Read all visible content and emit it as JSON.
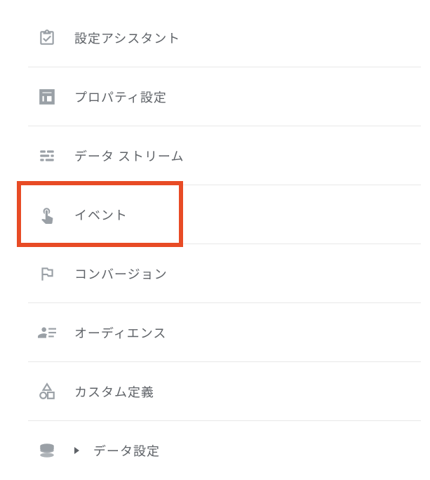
{
  "menu": {
    "items": [
      {
        "label": "設定アシスタント",
        "icon": "clipboard-check-icon"
      },
      {
        "label": "プロパティ設定",
        "icon": "layout-icon"
      },
      {
        "label": "データ ストリーム",
        "icon": "stream-icon"
      },
      {
        "label": "イベント",
        "icon": "touch-icon",
        "highlighted": true
      },
      {
        "label": "コンバージョン",
        "icon": "flag-icon"
      },
      {
        "label": "オーディエンス",
        "icon": "audience-icon"
      },
      {
        "label": "カスタム定義",
        "icon": "shapes-icon"
      },
      {
        "label": "データ設定",
        "icon": "database-icon",
        "expandable": true
      }
    ]
  }
}
